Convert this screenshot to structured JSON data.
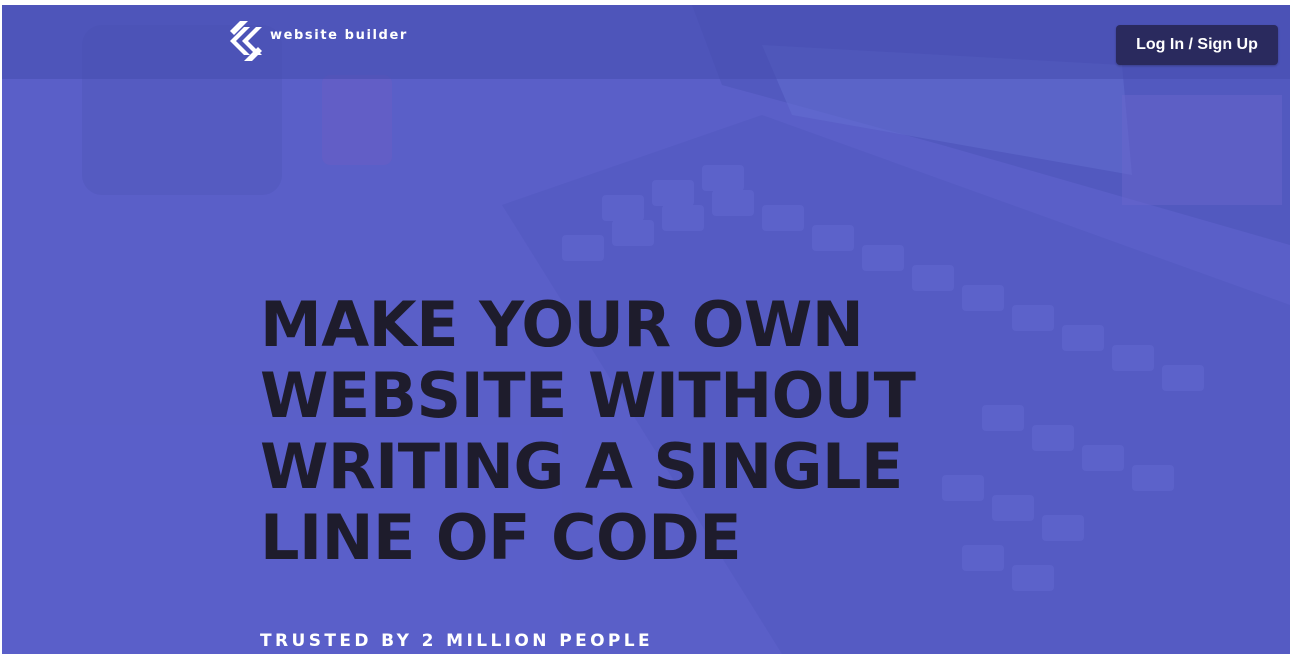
{
  "brand": {
    "logo_text": "website builder",
    "logo_icon": "chevron-double-logo-icon"
  },
  "header": {
    "login_label": "Log In / Sign Up"
  },
  "hero": {
    "headline_lines": [
      "MAKE YOUR OWN",
      "WEBSITE WITHOUT",
      "WRITING A SINGLE",
      "LINE OF CODE"
    ],
    "tagline": "TRUSTED BY 2 MILLION PEOPLE",
    "background_image": "laptop-keyboard-photo"
  },
  "colors": {
    "hero_overlay": "#5a5fc8",
    "button_bg": "#2a2a5e",
    "headline_text": "#1e1c2c",
    "white": "#ffffff"
  }
}
